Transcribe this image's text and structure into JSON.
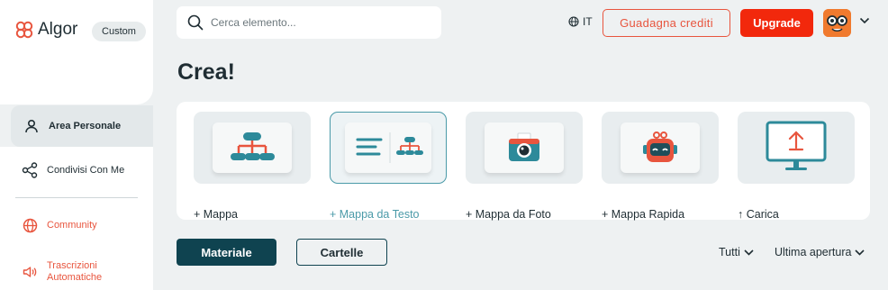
{
  "brand": {
    "name": "Algor",
    "plan_badge": "Custom"
  },
  "sidebar": {
    "items": [
      {
        "label": "Area Personale",
        "icon": "user-icon"
      },
      {
        "label": "Condivisi Con Me",
        "icon": "share-icon"
      },
      {
        "label": "Community",
        "icon": "globe-icon"
      },
      {
        "label": "Trascrizioni Automatiche",
        "icon": "speaker-icon"
      }
    ]
  },
  "header": {
    "search_placeholder": "Cerca elemento...",
    "language": "IT",
    "earn_credits_label": "Guadagna crediti",
    "upgrade_label": "Upgrade"
  },
  "main": {
    "title": "Crea!",
    "cards": [
      {
        "label": "+ Mappa",
        "icon": "mind-map-icon"
      },
      {
        "label": "+ Mappa da Testo",
        "icon": "text-to-map-icon"
      },
      {
        "label": "+ Mappa da Foto",
        "icon": "camera-icon"
      },
      {
        "label": "+ Mappa Rapida",
        "icon": "robot-icon"
      },
      {
        "label": "↑ Carica",
        "icon": "upload-monitor-icon"
      }
    ],
    "tabs": {
      "materials_label": "Materiale",
      "folders_label": "Cartelle"
    },
    "filters": {
      "all_label": "Tutti",
      "sort_label": "Ultima apertura"
    }
  },
  "colors": {
    "accent_orange": "#e8553e",
    "upgrade_red": "#f2280c",
    "dark_teal": "#0f4350",
    "selected_teal": "#4a9aa8"
  }
}
